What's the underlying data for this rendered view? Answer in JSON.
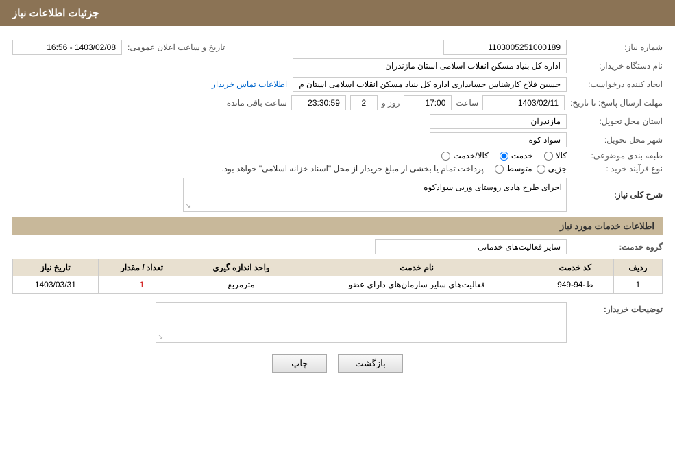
{
  "header": {
    "title": "جزئیات اطلاعات نیاز"
  },
  "fields": {
    "need_number_label": "شماره نیاز:",
    "need_number_value": "1103005251000189",
    "date_label": "تاریخ و ساعت اعلان عمومی:",
    "date_value": "1403/02/08 - 16:56",
    "buyer_org_label": "نام دستگاه خریدار:",
    "buyer_org_value": "اداره کل بنیاد مسکن انقلاب اسلامی استان مازندران",
    "requester_label": "ایجاد کننده درخواست:",
    "requester_value": "جسین فلاح کارشناس حسابداری اداره کل بنیاد مسکن انقلاب اسلامی استان م",
    "contact_link": "اطلاعات تماس خریدار",
    "response_deadline_label": "مهلت ارسال پاسخ: تا تاریخ:",
    "deadline_date": "1403/02/11",
    "deadline_time_label": "ساعت",
    "deadline_time": "17:00",
    "deadline_days_label": "روز و",
    "deadline_days": "2",
    "deadline_remaining_label": "ساعت باقی مانده",
    "deadline_remaining": "23:30:59",
    "province_label": "استان محل تحویل:",
    "province_value": "مازندران",
    "city_label": "شهر محل تحویل:",
    "city_value": "سواد کوه",
    "category_label": "طبقه بندی موضوعی:",
    "category_options": [
      {
        "label": "کالا",
        "selected": false
      },
      {
        "label": "خدمت",
        "selected": true
      },
      {
        "label": "کالا/خدمت",
        "selected": false
      }
    ],
    "purchase_type_label": "نوع فرآیند خرید :",
    "purchase_type_options": [
      {
        "label": "جزیی",
        "selected": false
      },
      {
        "label": "متوسط",
        "selected": false
      }
    ],
    "purchase_type_note": "پرداخت تمام یا بخشی از مبلغ خریدار از محل \"اسناد خزانه اسلامی\" خواهد بود.",
    "general_description_label": "شرح کلی نیاز:",
    "general_description_value": "اجرای طرح هادی روستای وریی سوادکوه",
    "services_section_title": "اطلاعات خدمات مورد نیاز",
    "service_group_label": "گروه خدمت:",
    "service_group_value": "سایر فعالیت‌های خدماتی",
    "table": {
      "columns": [
        "ردیف",
        "کد خدمت",
        "نام خدمت",
        "واحد اندازه گیری",
        "تعداد / مقدار",
        "تاریخ نیاز"
      ],
      "rows": [
        {
          "row_num": "1",
          "service_code": "ط-94-949",
          "service_name": "فعالیت‌های سایر سازمان‌های دارای عضو",
          "unit": "مترمربع",
          "quantity": "1",
          "date": "1403/03/31"
        }
      ]
    },
    "buyer_notes_label": "توضیحات خریدار:"
  },
  "buttons": {
    "print_label": "چاپ",
    "back_label": "بازگشت"
  }
}
